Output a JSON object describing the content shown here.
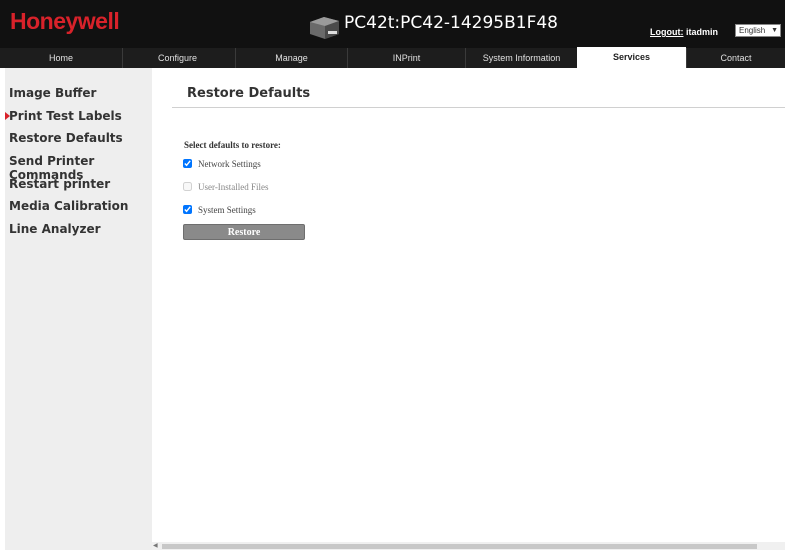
{
  "header": {
    "brand": "Honeywell",
    "device": "PC42t:PC42-14295B1F48",
    "logout_label": "Logout:",
    "user": "itadmin",
    "language": "English"
  },
  "nav": {
    "tabs": [
      {
        "label": "Home"
      },
      {
        "label": "Configure"
      },
      {
        "label": "Manage"
      },
      {
        "label": "INPrint"
      },
      {
        "label": "System Information"
      },
      {
        "label": "Services",
        "active": true
      },
      {
        "label": "Contact"
      }
    ]
  },
  "sidebar": {
    "items": [
      {
        "label": "Image Buffer"
      },
      {
        "label": "Print Test Labels",
        "current": true
      },
      {
        "label": "Restore Defaults"
      },
      {
        "label": "Send Printer Commands"
      },
      {
        "label": "Restart printer"
      },
      {
        "label": "Media Calibration"
      },
      {
        "label": "Line Analyzer"
      }
    ]
  },
  "main": {
    "title": "Restore Defaults",
    "select_label": "Select defaults to restore:",
    "options": [
      {
        "label": "Network Settings",
        "checked": true,
        "enabled": true
      },
      {
        "label": "User-Installed Files",
        "checked": false,
        "enabled": false
      },
      {
        "label": "System Settings",
        "checked": true,
        "enabled": true
      }
    ],
    "restore_button": "Restore"
  },
  "colors": {
    "brand": "#d8222a",
    "topbar": "#111111",
    "sidebar_bg": "#eeeeee",
    "button_bg": "#8a8a8a"
  }
}
